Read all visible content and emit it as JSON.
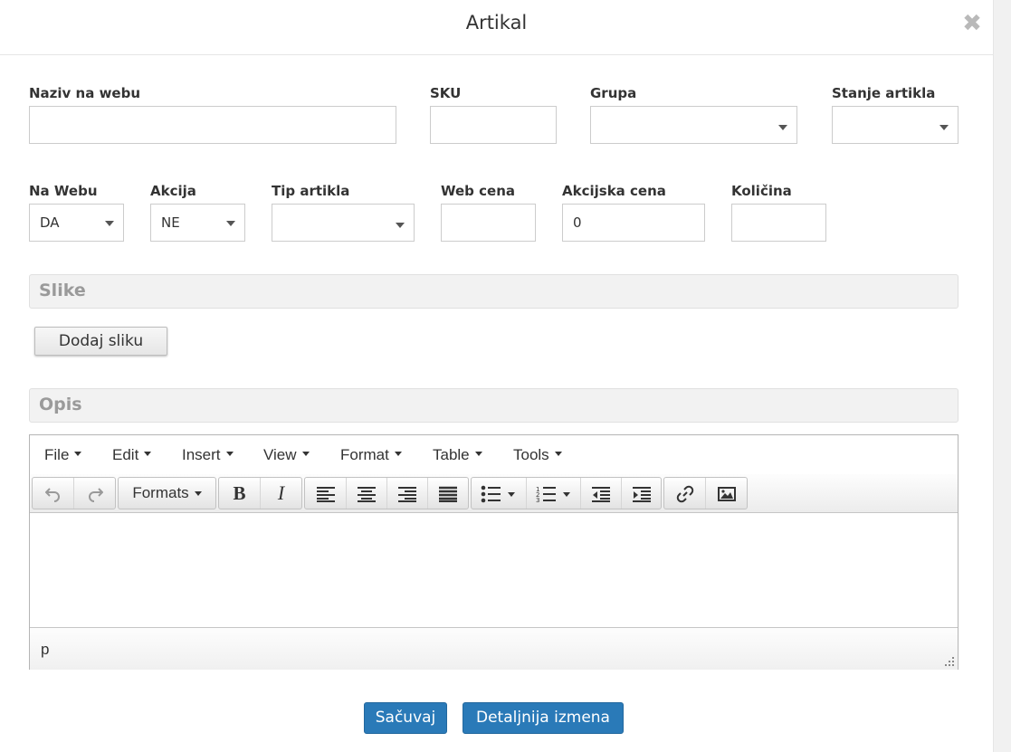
{
  "dialog": {
    "title": "Artikal",
    "close_glyph": "✖"
  },
  "fields": {
    "naziv_na_webu": {
      "label": "Naziv na webu",
      "value": ""
    },
    "sku": {
      "label": "SKU",
      "value": ""
    },
    "grupa": {
      "label": "Grupa",
      "value": ""
    },
    "stanje_artikla": {
      "label": "Stanje artikla",
      "value": ""
    },
    "na_webu": {
      "label": "Na Webu",
      "value": "DA"
    },
    "akcija": {
      "label": "Akcija",
      "value": "NE"
    },
    "tip_artikla": {
      "label": "Tip artikla",
      "value": ""
    },
    "web_cena": {
      "label": "Web cena",
      "value": ""
    },
    "akcijska_cena": {
      "label": "Akcijska cena",
      "value": "0"
    },
    "kolicina": {
      "label": "Količina",
      "value": ""
    }
  },
  "slike": {
    "heading": "Slike",
    "add_button": "Dodaj sliku"
  },
  "opis": {
    "heading": "Opis"
  },
  "editor": {
    "menus": [
      "File",
      "Edit",
      "Insert",
      "View",
      "Format",
      "Table",
      "Tools"
    ],
    "formats_label": "Formats",
    "toolbar_icons": [
      "undo-icon",
      "redo-icon",
      "bold-icon",
      "italic-icon",
      "align-left-icon",
      "align-center-icon",
      "align-right-icon",
      "align-justify-icon",
      "bullet-list-icon",
      "numbered-list-icon",
      "outdent-icon",
      "indent-icon",
      "link-icon",
      "image-icon"
    ],
    "content": "",
    "status_path": "p"
  },
  "buttons": {
    "save": "Sačuvaj",
    "details": "Detaljnija izmena"
  },
  "colors": {
    "primary": "#2a7ab8",
    "section_bg": "#f2f2f2",
    "section_text": "#9a9a9a"
  }
}
